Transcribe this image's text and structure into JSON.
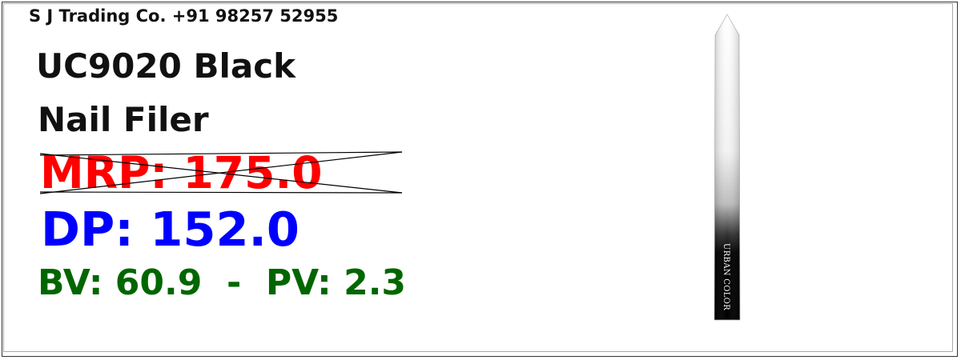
{
  "seller": "S J Trading Co. +91 98257 52955",
  "product": {
    "title_line1": "UC9020 Black",
    "title_line2": "Nail Filer",
    "brand_on_image": "URBAN COLOR",
    "image_icon": "nail-file-illustration"
  },
  "pricing": {
    "mrp_label": "MRP: 175.0",
    "dp_label": "DP: 152.0",
    "bv_label": "BV: 60.9",
    "separator": "  -  ",
    "pv_label": "PV: 2.3"
  },
  "colors": {
    "mrp": "#ff0000",
    "dp": "#0000ff",
    "bv_pv": "#006600",
    "text": "#111111"
  }
}
